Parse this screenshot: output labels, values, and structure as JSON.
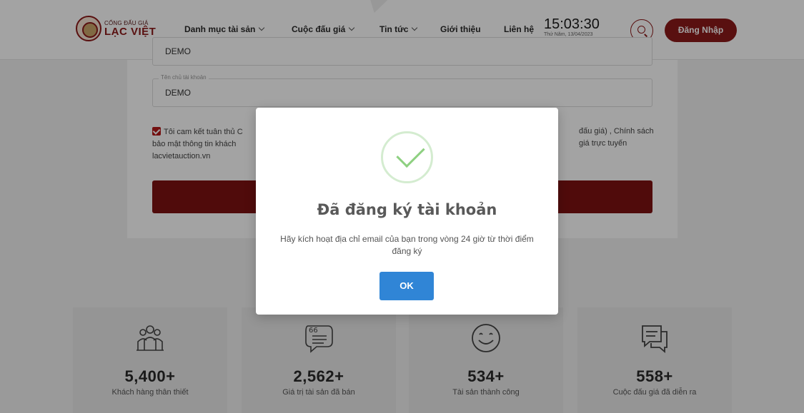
{
  "header": {
    "logo_top": "CỔNG ĐẤU GIÁ",
    "logo_main": "LẠC VIỆT",
    "nav": [
      {
        "label": "Danh mục tài sản"
      },
      {
        "label": "Cuộc đấu giá"
      },
      {
        "label": "Tin tức"
      },
      {
        "label": "Giới thiệu"
      },
      {
        "label": "Liên hệ"
      }
    ],
    "clock_time": "15:03:30",
    "clock_date": "Thứ Năm, 13/04/2023",
    "login_label": "Đăng Nhập"
  },
  "form": {
    "prev_field_value": "DEMO",
    "owner_label": "Tên chủ tài khoản",
    "owner_value": "DEMO",
    "consent_left": "Tôi cam kết tuân thủ C",
    "consent_left_2": "bảo mật thông tin khách",
    "consent_left_3": "lacvietauction.vn",
    "consent_right": "đấu giá) , Chính sách",
    "consent_right_2": "giá trực tuyến"
  },
  "stats": [
    {
      "value": "5,400+",
      "label": "Khách hàng thân thiết",
      "icon": "customers-icon"
    },
    {
      "value": "2,562+",
      "label": "Giá trị tài sản đã bán",
      "icon": "quote-bubble-icon"
    },
    {
      "value": "534+",
      "label": "Tài sản thành công",
      "icon": "smile-icon"
    },
    {
      "value": "558+",
      "label": "Cuộc đấu giá đã diễn ra",
      "icon": "chat-icon"
    }
  ],
  "modal": {
    "title": "Đã đăng ký tài khoản",
    "message": "Hãy kích hoạt địa chỉ email của bạn trong vòng 24 giờ từ thời điểm đăng ký",
    "ok_label": "OK"
  },
  "colors": {
    "brand": "#8b1a1a",
    "ok_button": "#3085d6",
    "success": "#8ed081"
  }
}
